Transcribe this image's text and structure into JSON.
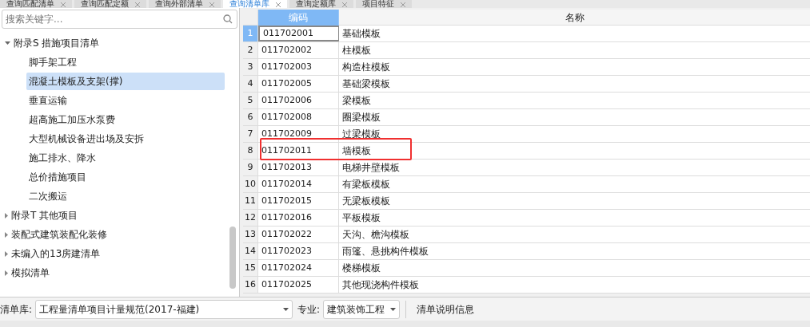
{
  "tabs": [
    {
      "label": "查询匹配清单",
      "selected": false
    },
    {
      "label": "查询匹配定额",
      "selected": false
    },
    {
      "label": "查询外部清单",
      "selected": false
    },
    {
      "label": "查询清单库",
      "selected": true
    },
    {
      "label": "查询定额库",
      "selected": false
    },
    {
      "label": "项目特征",
      "selected": false
    }
  ],
  "search": {
    "placeholder": "搜索关键字..."
  },
  "tree": [
    {
      "label": "附录S 措施项目清单",
      "expanded": true,
      "children": [
        {
          "label": "脚手架工程",
          "selected": false
        },
        {
          "label": "混凝土模板及支架(撑)",
          "selected": true
        },
        {
          "label": "垂直运输",
          "selected": false
        },
        {
          "label": "超高施工加压水泵费",
          "selected": false
        },
        {
          "label": "大型机械设备进出场及安拆",
          "selected": false
        },
        {
          "label": "施工排水、降水",
          "selected": false
        },
        {
          "label": "总价措施项目",
          "selected": false
        },
        {
          "label": "二次搬运",
          "selected": false
        }
      ]
    },
    {
      "label": "附录T 其他项目",
      "expanded": false
    },
    {
      "label": "装配式建筑装配化装修",
      "expanded": false
    },
    {
      "label": "未编入的13房建清单",
      "expanded": false
    },
    {
      "label": "模拟清单",
      "expanded": false
    }
  ],
  "table": {
    "columns": [
      "编码",
      "名称"
    ],
    "rows": [
      {
        "index": "1",
        "code": "011702001",
        "name": "基础模板",
        "selected": true,
        "highlighted": false
      },
      {
        "index": "2",
        "code": "011702002",
        "name": "柱模板",
        "selected": false,
        "highlighted": false
      },
      {
        "index": "3",
        "code": "011702003",
        "name": "构造柱模板",
        "selected": false,
        "highlighted": false
      },
      {
        "index": "4",
        "code": "011702005",
        "name": "基础梁模板",
        "selected": false,
        "highlighted": false
      },
      {
        "index": "5",
        "code": "011702006",
        "name": "梁模板",
        "selected": false,
        "highlighted": false
      },
      {
        "index": "6",
        "code": "011702008",
        "name": "圈梁模板",
        "selected": false,
        "highlighted": false
      },
      {
        "index": "7",
        "code": "011702009",
        "name": "过梁模板",
        "selected": false,
        "highlighted": false
      },
      {
        "index": "8",
        "code": "011702011",
        "name": "墙模板",
        "selected": false,
        "highlighted": true
      },
      {
        "index": "9",
        "code": "011702013",
        "name": "电梯井壁模板",
        "selected": false,
        "highlighted": false
      },
      {
        "index": "10",
        "code": "011702014",
        "name": "有梁板模板",
        "selected": false,
        "highlighted": false
      },
      {
        "index": "11",
        "code": "011702015",
        "name": "无梁板模板",
        "selected": false,
        "highlighted": false
      },
      {
        "index": "12",
        "code": "011702016",
        "name": "平板模板",
        "selected": false,
        "highlighted": false
      },
      {
        "index": "13",
        "code": "011702022",
        "name": "天沟、檐沟模板",
        "selected": false,
        "highlighted": false
      },
      {
        "index": "14",
        "code": "011702023",
        "name": "雨篷、悬挑构件模板",
        "selected": false,
        "highlighted": false
      },
      {
        "index": "15",
        "code": "011702024",
        "name": "楼梯模板",
        "selected": false,
        "highlighted": false
      },
      {
        "index": "16",
        "code": "011702025",
        "name": "其他现浇构件模板",
        "selected": false,
        "highlighted": false
      }
    ]
  },
  "bottom_bar": {
    "library_label": "清单库:",
    "library_value": "工程量清单项目计量规范(2017-福建)",
    "specialty_label": "专业:",
    "specialty_value": "建筑装饰工程",
    "info_button": "清单说明信息"
  }
}
